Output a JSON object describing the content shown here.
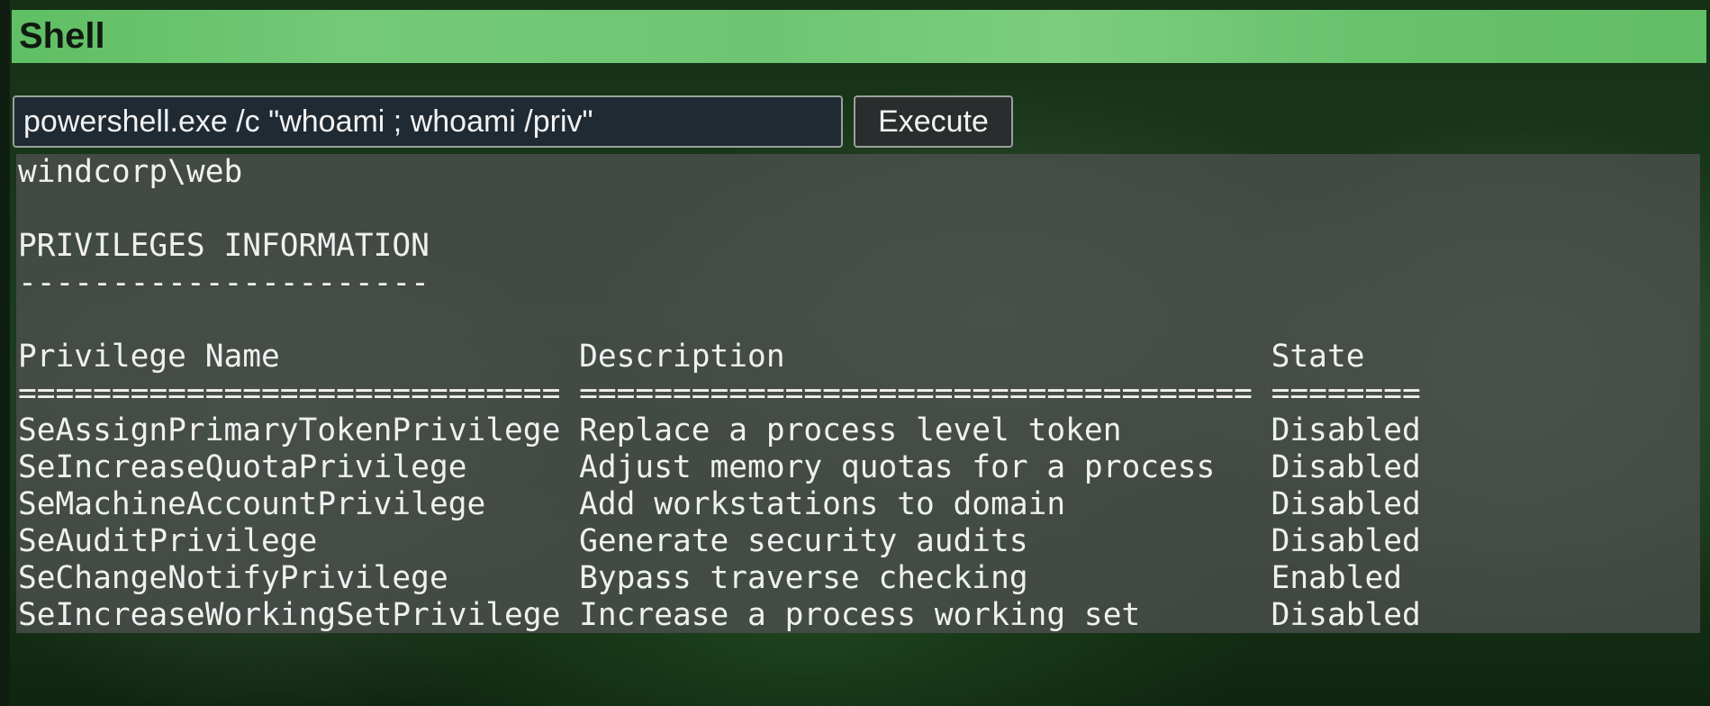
{
  "header": {
    "title": "Shell"
  },
  "command": {
    "value": "powershell.exe /c \"whoami ; whoami /priv\""
  },
  "execute_label": "Execute",
  "output": {
    "lines": [
      "windcorp\\web",
      "",
      "PRIVILEGES INFORMATION",
      "----------------------",
      "",
      "Privilege Name                Description                          State",
      "============================= ==================================== ========",
      "SeAssignPrimaryTokenPrivilege Replace a process level token        Disabled",
      "SeIncreaseQuotaPrivilege      Adjust memory quotas for a process   Disabled",
      "SeMachineAccountPrivilege     Add workstations to domain           Disabled",
      "SeAuditPrivilege              Generate security audits             Disabled",
      "SeChangeNotifyPrivilege       Bypass traverse checking             Enabled",
      "SeIncreaseWorkingSetPrivilege Increase a process working set       Disabled"
    ]
  },
  "colors": {
    "header_accent": "#6ec672",
    "input_background": "#1f2a33",
    "output_background": "#4e5050"
  }
}
